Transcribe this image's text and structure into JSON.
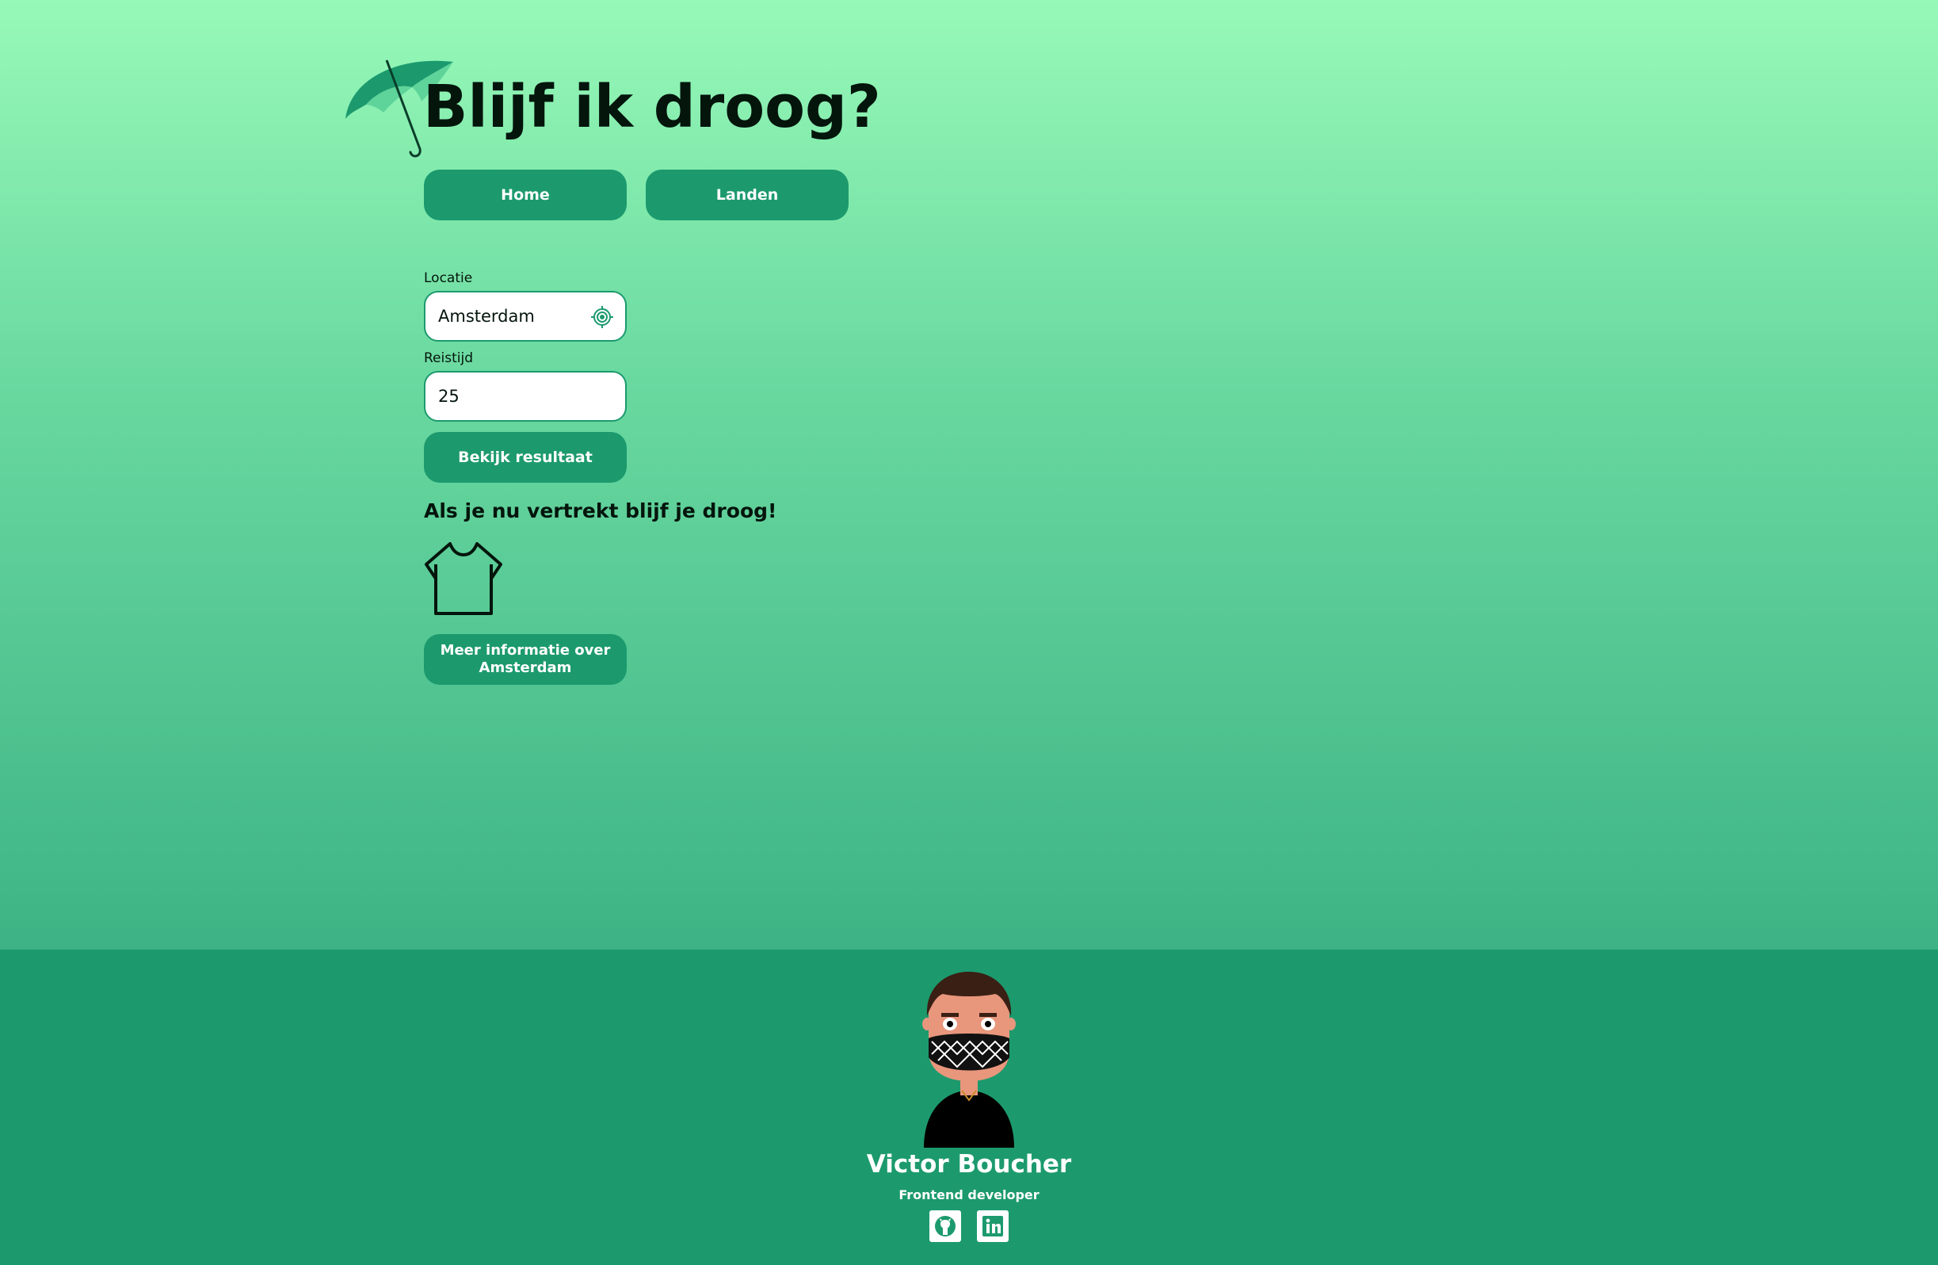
{
  "header": {
    "title": "Blijf ik droog?",
    "logo_icon": "umbrella-icon"
  },
  "nav": {
    "items": [
      {
        "label": "Home"
      },
      {
        "label": "Landen"
      }
    ]
  },
  "form": {
    "location": {
      "label": "Locatie",
      "value": "Amsterdam",
      "icon": "locate-target-icon"
    },
    "travel_time": {
      "label": "Reistijd",
      "value": "25"
    },
    "submit_label": "Bekijk resultaat"
  },
  "result": {
    "message": "Als je nu vertrekt blijf je droog!",
    "clothing_icon": "tshirt-icon",
    "more_info_label": "Meer informatie over Amsterdam"
  },
  "footer": {
    "name": "Victor Boucher",
    "role": "Frontend developer",
    "socials": [
      {
        "icon": "github-icon"
      },
      {
        "icon": "linkedin-icon"
      }
    ]
  },
  "colors": {
    "accent": "#1c9a6e",
    "gradient_top": "#97f9b8",
    "gradient_bottom": "#3db385",
    "text_dark": "#04150c"
  }
}
